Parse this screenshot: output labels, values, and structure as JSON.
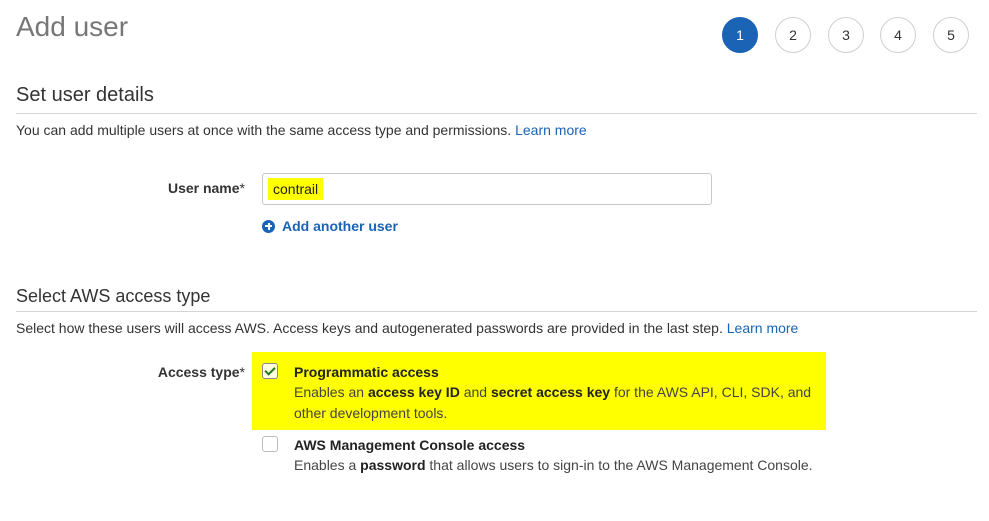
{
  "header": {
    "title": "Add user"
  },
  "steps": [
    "1",
    "2",
    "3",
    "4",
    "5"
  ],
  "details": {
    "title": "Set user details",
    "description": "You can add multiple users at once with the same access type and permissions.",
    "learn_more": "Learn more",
    "username_label": "User name",
    "required_mark": "*",
    "username_value": "contrail",
    "add_another": "Add another user"
  },
  "access": {
    "title": "Select AWS access type",
    "description": "Select how these users will access AWS. Access keys and autogenerated passwords are provided in the last step.",
    "learn_more": "Learn more",
    "label": "Access type",
    "required_mark": "*",
    "programmatic": {
      "title": "Programmatic access",
      "checked": true,
      "desc_1": "Enables an ",
      "desc_bold_1": "access key ID",
      "desc_2": " and ",
      "desc_bold_2": "secret access key",
      "desc_3": " for the AWS API, CLI, SDK, and",
      "desc_4": "other development tools."
    },
    "console": {
      "title": "AWS Management Console access",
      "checked": false,
      "desc_1": "Enables a ",
      "desc_bold_1": "password",
      "desc_2": " that allows users to sign-in to the AWS Management Console."
    }
  },
  "colors": {
    "accent": "#1a63b5",
    "highlight": "#ffff00",
    "check": "#1f7a1f"
  },
  "icons": {
    "add": "plus-circle-icon",
    "check": "checkmark-icon"
  }
}
